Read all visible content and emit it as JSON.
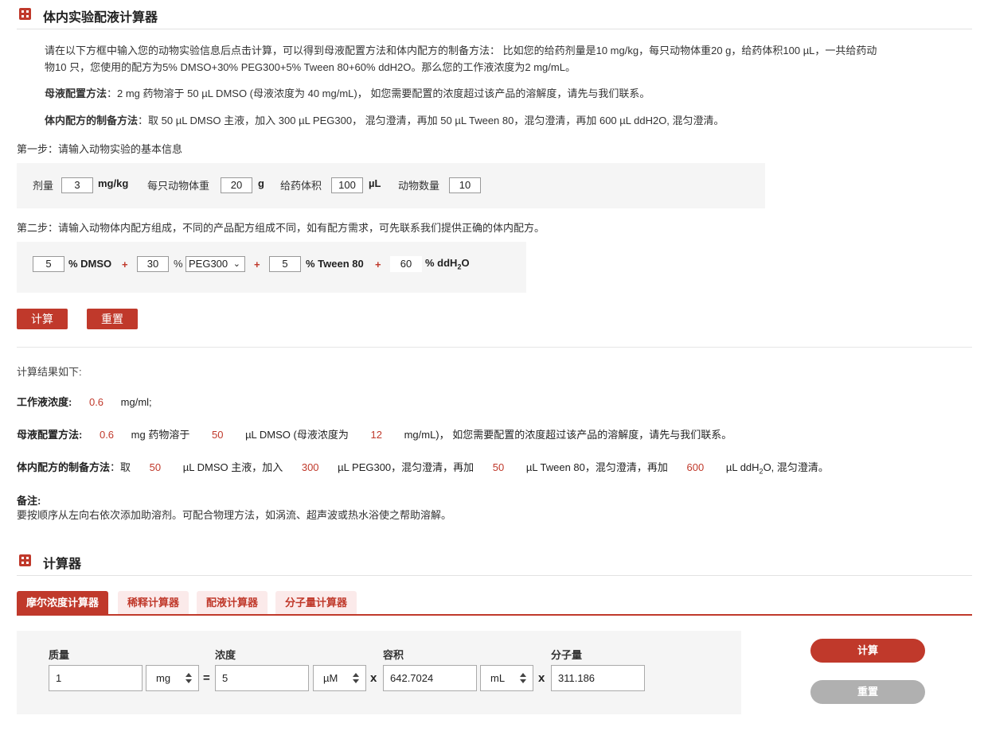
{
  "header": {
    "title": "体内实验配液计算器"
  },
  "intro": {
    "p1": "请在以下方框中输入您的动物实验信息后点击计算，可以得到母液配置方法和体内配方的制备方法： 比如您的给药剂量是10 mg/kg，每只动物体重20 g，给药体积100 µL，一共给药动",
    "p1b": "物10 只，您使用的配方为5% DMSO+30% PEG300+5% Tween 80+60% ddH2O。那么您的工作液浓度为2 mg/mL。",
    "p2_label": "母液配置方法",
    "p2_text": "：2 mg 药物溶于 50 µL DMSO (母液浓度为 40 mg/mL)， 如您需要配置的浓度超过该产品的溶解度，请先与我们联系。",
    "p3_label": "体内配方的制备方法",
    "p3_text": "：取 50 µL DMSO 主液，加入 300 µL PEG300， 混匀澄清，再加 50 µL Tween 80，混匀澄清，再加 600 µL ddH2O, 混匀澄清。"
  },
  "step1": {
    "title": "第一步：请输入动物实验的基本信息",
    "dose_label": "剂量",
    "dose_value": "3",
    "dose_unit": "mg/kg",
    "weight_label": "每只动物体重",
    "weight_value": "20",
    "weight_unit": "g",
    "volume_label": "给药体积",
    "volume_value": "100",
    "volume_unit": "µL",
    "count_label": "动物数量",
    "count_value": "10"
  },
  "step2": {
    "title": "第二步：请输入动物体内配方组成，不同的产品配方组成不同，如有配方需求，可先联系我们提供正确的体内配方。",
    "dmso_value": "5",
    "dmso_label": "% DMSO",
    "peg_value": "30",
    "peg_pct": "%",
    "peg_select": "PEG300",
    "tween_value": "5",
    "tween_label": "% Tween 80",
    "water_value": "60",
    "water_label_pre": "% ddH",
    "water_sub": "2",
    "water_label_post": "O",
    "plus": "+"
  },
  "buttons": {
    "calc": "计算",
    "reset": "重置"
  },
  "results": {
    "heading": "计算结果如下:",
    "work_label": "工作液浓度:",
    "work_value": "0.6",
    "work_unit": "mg/ml;",
    "stock_label": "母液配置方法:",
    "stock_mg": "0.6",
    "stock_t1": "mg 药物溶于",
    "stock_ul": "50",
    "stock_t2": "µL DMSO (母液浓度为",
    "stock_conc": "12",
    "stock_t3": "mg/mL)， 如您需要配置的浓度超过该产品的溶解度，请先与我们联系。",
    "prep_label": "体内配方的制备方法",
    "prep_t0": "：取",
    "prep_v1": "50",
    "prep_t1": "µL DMSO 主液，加入",
    "prep_v2": "300",
    "prep_t2": "µL PEG300，混匀澄清，再加",
    "prep_v3": "50",
    "prep_t3": "µL Tween 80，混匀澄清，再加",
    "prep_v4": "600",
    "prep_t4": "µL ddH",
    "prep_sub": "2",
    "prep_t5": "O, 混匀澄清。",
    "note_label": "备注:",
    "note_text": "要按顺序从左向右依次添加助溶剂。可配合物理方法，如涡流、超声波或热水浴使之帮助溶解。"
  },
  "calculator": {
    "title": "计算器",
    "tabs": [
      "摩尔浓度计算器",
      "稀释计算器",
      "配液计算器",
      "分子量计算器"
    ],
    "mass_label": "质量",
    "mass_value": "1",
    "mass_unit": "mg",
    "conc_label": "浓度",
    "conc_value": "5",
    "conc_unit": "µM",
    "vol_label": "容积",
    "vol_value": "642.7024",
    "vol_unit": "mL",
    "mw_label": "分子量",
    "mw_value": "311.186",
    "eq": "=",
    "times": "x",
    "calc_btn": "计算",
    "reset_btn": "重置"
  },
  "colors": {
    "accent": "#c0392b",
    "panel": "#f5f5f5",
    "disabled": "#b0b0b0"
  }
}
